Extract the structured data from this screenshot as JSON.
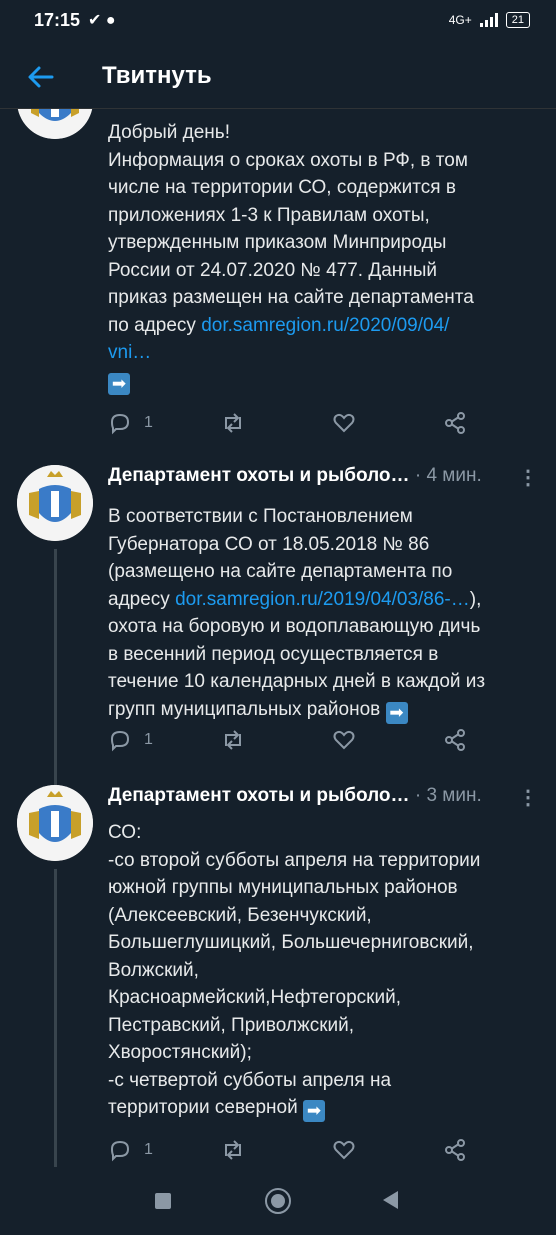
{
  "status_bar": {
    "time": "17:15",
    "left_icons": "✔ ●",
    "network": "4G+",
    "battery": "21"
  },
  "header": {
    "title": "Твитнуть",
    "back_icon": "arrow-left-icon"
  },
  "tweets": [
    {
      "name": "",
      "time": "",
      "lines": [
        "Добрый день!",
        "Информация о сроках охоты в РФ, в том",
        "числе на территории СО, содержится в",
        "приложениях 1-3 к Правилам охоты,",
        "утвержденным приказом Минприроды",
        "России от 24.07.2020 № 477. Данный",
        "приказ размещен на сайте департамента"
      ],
      "link_prefix": "по адресу ",
      "link": "dor.samregion.ru/2020/09/04/",
      "link_line2": "vni…",
      "replies": "1"
    },
    {
      "name": "Департамент охоты и рыболо…",
      "dot": "·",
      "time": "4 мин.",
      "more": "⋮",
      "lines": [
        "В соответствии с Постановлением",
        "Губернатора СО от 18.05.2018 № 86",
        "(размещено на сайте департамента по"
      ],
      "link_prefix": "адресу ",
      "link": "dor.samregion.ru/2019/04/03/86-…",
      "link_suffix": "),",
      "lines_after": [
        "охота на боровую и водоплавающую дичь",
        "в весенний период осуществляется в",
        "течение 10 календарных дней в каждой из"
      ],
      "last_line": "групп муниципальных районов",
      "replies": "1"
    },
    {
      "name": "Департамент охоты и рыболо…",
      "dot": "·",
      "time": "3 мин.",
      "more": "⋮",
      "lines": [
        "СО:",
        "-со второй субботы апреля на территории",
        "южной группы муниципальных районов",
        "(Алексеевский, Безенчукский,",
        "Большеглушицкий, Большечерниговский,",
        "Волжский,",
        "Красноармейский,Нефтегорский,",
        "Пестравский, Приволжский,",
        "Хворостянский);",
        "-с четвертой субботы апреля на"
      ],
      "last_line": "территории северной",
      "replies": "1"
    }
  ],
  "emoji": "➡",
  "colors": {
    "background": "#15202b",
    "link": "#1d9bf0",
    "secondary": "#8b98a5",
    "accent": "#1d9bf0"
  },
  "icons": [
    "reply-icon",
    "retweet-icon",
    "like-icon",
    "share-icon"
  ]
}
